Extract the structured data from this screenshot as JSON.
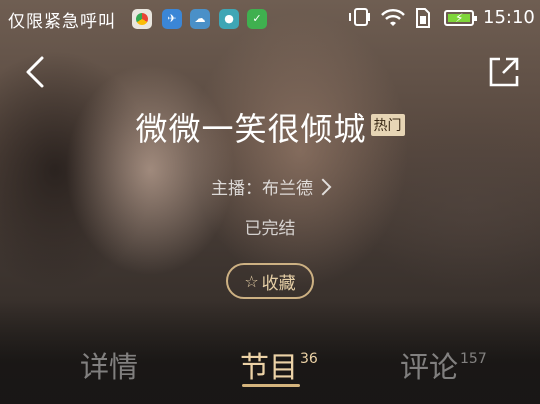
{
  "status_bar": {
    "notice": "仅限紧急呼叫",
    "time": "15:10",
    "notification_icons": [
      "browser-icon",
      "app-icon",
      "cloud-icon",
      "chat-icon",
      "wechat-icon"
    ]
  },
  "header": {
    "title": "微微一笑很倾城",
    "badge": "热门",
    "host_label": "主播：布兰德",
    "status": "已完结",
    "collect_label": "收藏"
  },
  "tabs": [
    {
      "label": "详情",
      "count": ""
    },
    {
      "label": "节目",
      "count": "36"
    },
    {
      "label": "评论",
      "count": "157"
    }
  ],
  "colors": {
    "accent": "#d4b47d",
    "badge_bg": "#e7d5b5"
  }
}
